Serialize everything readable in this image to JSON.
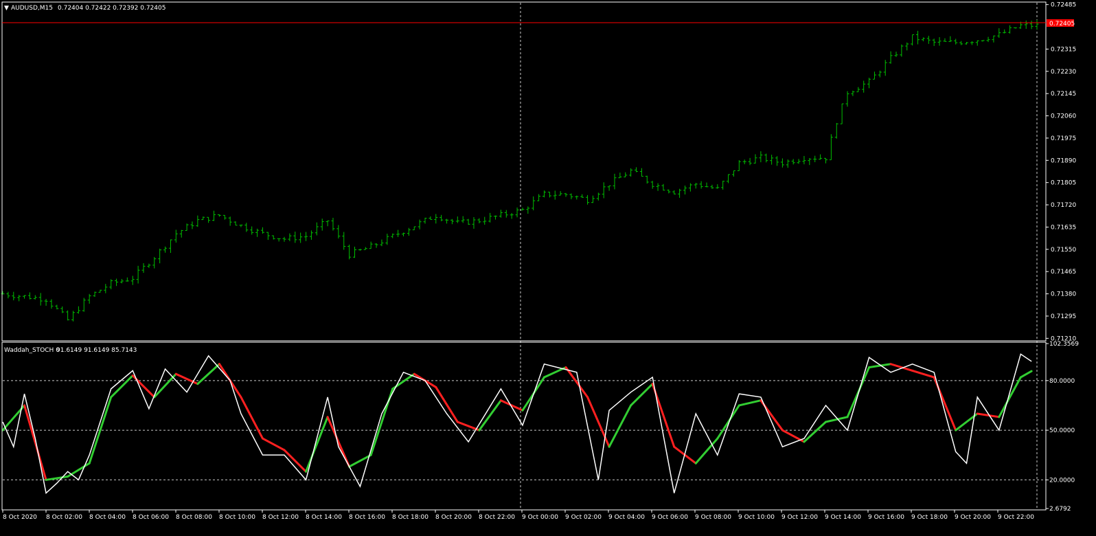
{
  "main_header": {
    "symbol": "AUDUSD,M15",
    "ohlc": "0.72404 0.72422 0.72392 0.72405"
  },
  "indicator_header": {
    "name": "Waddah_STOCH 0",
    "values": "91.6149 91.6149 85.7143"
  },
  "price_axis": {
    "ticks": [
      "0.72485",
      "0.72405",
      "0.72315",
      "0.72230",
      "0.72145",
      "0.72060",
      "0.71975",
      "0.71890",
      "0.71805",
      "0.71720",
      "0.71635",
      "0.71550",
      "0.71465",
      "0.71380",
      "0.71295",
      "0.71210"
    ],
    "current_price_label": "0.72405",
    "range": [
      0.71203,
      0.72492
    ]
  },
  "indicator_axis": {
    "ticks": [
      "102.3569",
      "80.0000",
      "50.0000",
      "20.0000",
      "2.6792"
    ],
    "levels": [
      80,
      50,
      20
    ],
    "range": [
      2.6792,
      102.3569
    ]
  },
  "time_axis": {
    "ticks": [
      "8 Oct 2020",
      "8 Oct 02:00",
      "8 Oct 04:00",
      "8 Oct 06:00",
      "8 Oct 08:00",
      "8 Oct 10:00",
      "8 Oct 12:00",
      "8 Oct 14:00",
      "8 Oct 16:00",
      "8 Oct 18:00",
      "8 Oct 20:00",
      "8 Oct 22:00",
      "9 Oct 00:00",
      "9 Oct 02:00",
      "9 Oct 04:00",
      "9 Oct 06:00",
      "9 Oct 08:00",
      "9 Oct 10:00",
      "9 Oct 12:00",
      "9 Oct 14:00",
      "9 Oct 16:00",
      "9 Oct 18:00",
      "9 Oct 20:00",
      "9 Oct 22:00"
    ]
  },
  "colors": {
    "background": "#000000",
    "candle": "#00c000",
    "current_price_line": "#ff0000",
    "axis_text": "#ffffff",
    "stoch_main": "#ffffff",
    "signal_up": "#32cd32",
    "signal_down": "#ff2020"
  },
  "chart_data": [
    {
      "type": "line",
      "chart": "price-bars",
      "title": "AUDUSD,M15",
      "timeframe_minutes": 15,
      "closing_price_path": [
        {
          "time": "8 Oct 2020 00:00",
          "close": 0.7138
        },
        {
          "time": "8 Oct 02:00",
          "close": 0.7136
        },
        {
          "time": "8 Oct 03:00",
          "close": 0.7128
        },
        {
          "time": "8 Oct 04:00",
          "close": 0.7137
        },
        {
          "time": "8 Oct 05:00",
          "close": 0.7142
        },
        {
          "time": "8 Oct 06:00",
          "close": 0.7144
        },
        {
          "time": "8 Oct 07:00",
          "close": 0.7152
        },
        {
          "time": "8 Oct 08:00",
          "close": 0.7161
        },
        {
          "time": "8 Oct 09:00",
          "close": 0.7166
        },
        {
          "time": "8 Oct 10:00",
          "close": 0.7168
        },
        {
          "time": "8 Oct 11:00",
          "close": 0.7164
        },
        {
          "time": "8 Oct 12:00",
          "close": 0.7161
        },
        {
          "time": "8 Oct 13:00",
          "close": 0.7159
        },
        {
          "time": "8 Oct 14:00",
          "close": 0.716
        },
        {
          "time": "8 Oct 15:00",
          "close": 0.7166
        },
        {
          "time": "8 Oct 16:00",
          "close": 0.7153
        },
        {
          "time": "8 Oct 17:00",
          "close": 0.7156
        },
        {
          "time": "8 Oct 18:00",
          "close": 0.716
        },
        {
          "time": "8 Oct 19:00",
          "close": 0.7164
        },
        {
          "time": "8 Oct 20:00",
          "close": 0.7168
        },
        {
          "time": "8 Oct 21:00",
          "close": 0.7165
        },
        {
          "time": "8 Oct 22:00",
          "close": 0.7166
        },
        {
          "time": "8 Oct 23:00",
          "close": 0.7168
        },
        {
          "time": "9 Oct 00:00",
          "close": 0.717
        },
        {
          "time": "9 Oct 01:00",
          "close": 0.7176
        },
        {
          "time": "9 Oct 02:00",
          "close": 0.7176
        },
        {
          "time": "9 Oct 03:00",
          "close": 0.7174
        },
        {
          "time": "9 Oct 04:00",
          "close": 0.718
        },
        {
          "time": "9 Oct 05:00",
          "close": 0.7185
        },
        {
          "time": "9 Oct 06:00",
          "close": 0.718
        },
        {
          "time": "9 Oct 07:00",
          "close": 0.7177
        },
        {
          "time": "9 Oct 08:00",
          "close": 0.718
        },
        {
          "time": "9 Oct 09:00",
          "close": 0.7178
        },
        {
          "time": "9 Oct 10:00",
          "close": 0.7188
        },
        {
          "time": "9 Oct 11:00",
          "close": 0.719
        },
        {
          "time": "9 Oct 12:00",
          "close": 0.7188
        },
        {
          "time": "9 Oct 13:00",
          "close": 0.719
        },
        {
          "time": "9 Oct 14:00",
          "close": 0.719
        },
        {
          "time": "9 Oct 14:30",
          "close": 0.7204
        },
        {
          "time": "9 Oct 15:00",
          "close": 0.7215
        },
        {
          "time": "9 Oct 16:00",
          "close": 0.7219
        },
        {
          "time": "9 Oct 17:00",
          "close": 0.7228
        },
        {
          "time": "9 Oct 18:00",
          "close": 0.7236
        },
        {
          "time": "9 Oct 19:00",
          "close": 0.7234
        },
        {
          "time": "9 Oct 20:00",
          "close": 0.7234
        },
        {
          "time": "9 Oct 21:00",
          "close": 0.7235
        },
        {
          "time": "9 Oct 22:00",
          "close": 0.7237
        },
        {
          "time": "9 Oct 23:00",
          "close": 0.72405
        }
      ],
      "current_price": 0.72405,
      "ylim": [
        0.71203,
        0.72492
      ]
    },
    {
      "type": "line",
      "chart": "stochastic",
      "title": "Waddah_STOCH 0",
      "ylim": [
        2.6792,
        102.3569
      ],
      "levels": [
        80,
        50,
        20
      ],
      "main_line": [
        {
          "time": "8 Oct 2020 00:00",
          "value": 55
        },
        {
          "time": "8 Oct 00:30",
          "value": 40
        },
        {
          "time": "8 Oct 01:00",
          "value": 72
        },
        {
          "time": "8 Oct 01:30",
          "value": 45
        },
        {
          "time": "8 Oct 02:00",
          "value": 12
        },
        {
          "time": "8 Oct 02:30",
          "value": 18
        },
        {
          "time": "8 Oct 03:00",
          "value": 25
        },
        {
          "time": "8 Oct 03:30",
          "value": 20
        },
        {
          "time": "8 Oct 04:00",
          "value": 35
        },
        {
          "time": "8 Oct 05:00",
          "value": 75
        },
        {
          "time": "8 Oct 06:00",
          "value": 86
        },
        {
          "time": "8 Oct 06:45",
          "value": 63
        },
        {
          "time": "8 Oct 07:30",
          "value": 87
        },
        {
          "time": "8 Oct 08:30",
          "value": 73
        },
        {
          "time": "8 Oct 09:30",
          "value": 95
        },
        {
          "time": "8 Oct 10:30",
          "value": 80
        },
        {
          "time": "8 Oct 11:00",
          "value": 60
        },
        {
          "time": "8 Oct 12:00",
          "value": 35
        },
        {
          "time": "8 Oct 13:00",
          "value": 35
        },
        {
          "time": "8 Oct 14:00",
          "value": 20
        },
        {
          "time": "8 Oct 15:00",
          "value": 70
        },
        {
          "time": "8 Oct 15:30",
          "value": 40
        },
        {
          "time": "8 Oct 16:30",
          "value": 16
        },
        {
          "time": "8 Oct 17:30",
          "value": 60
        },
        {
          "time": "8 Oct 18:30",
          "value": 85
        },
        {
          "time": "8 Oct 19:30",
          "value": 80
        },
        {
          "time": "8 Oct 20:30",
          "value": 60
        },
        {
          "time": "8 Oct 21:30",
          "value": 43
        },
        {
          "time": "8 Oct 23:00",
          "value": 75
        },
        {
          "time": "9 Oct 00:00",
          "value": 53
        },
        {
          "time": "9 Oct 01:00",
          "value": 90
        },
        {
          "time": "9 Oct 02:30",
          "value": 85
        },
        {
          "time": "9 Oct 03:30",
          "value": 20
        },
        {
          "time": "9 Oct 04:00",
          "value": 62
        },
        {
          "time": "9 Oct 05:00",
          "value": 73
        },
        {
          "time": "9 Oct 06:00",
          "value": 82
        },
        {
          "time": "9 Oct 07:00",
          "value": 12
        },
        {
          "time": "9 Oct 08:00",
          "value": 60
        },
        {
          "time": "9 Oct 09:00",
          "value": 35
        },
        {
          "time": "9 Oct 10:00",
          "value": 72
        },
        {
          "time": "9 Oct 11:00",
          "value": 70
        },
        {
          "time": "9 Oct 12:00",
          "value": 40
        },
        {
          "time": "9 Oct 13:00",
          "value": 45
        },
        {
          "time": "9 Oct 14:00",
          "value": 65
        },
        {
          "time": "9 Oct 15:00",
          "value": 50
        },
        {
          "time": "9 Oct 16:00",
          "value": 94
        },
        {
          "time": "9 Oct 17:00",
          "value": 85
        },
        {
          "time": "9 Oct 18:00",
          "value": 90
        },
        {
          "time": "9 Oct 19:00",
          "value": 85
        },
        {
          "time": "9 Oct 20:00",
          "value": 37
        },
        {
          "time": "9 Oct 20:30",
          "value": 30
        },
        {
          "time": "9 Oct 21:00",
          "value": 70
        },
        {
          "time": "9 Oct 22:00",
          "value": 50
        },
        {
          "time": "9 Oct 23:00",
          "value": 96
        },
        {
          "time": "9 Oct 23:30",
          "value": 91.6149
        }
      ],
      "signal_line": [
        {
          "time": "8 Oct 2020 00:00",
          "value": 50
        },
        {
          "time": "8 Oct 01:00",
          "value": 65
        },
        {
          "time": "8 Oct 02:00",
          "value": 20
        },
        {
          "time": "8 Oct 03:00",
          "value": 22
        },
        {
          "time": "8 Oct 04:00",
          "value": 30
        },
        {
          "time": "8 Oct 05:00",
          "value": 70
        },
        {
          "time": "8 Oct 06:00",
          "value": 83
        },
        {
          "time": "8 Oct 07:00",
          "value": 70
        },
        {
          "time": "8 Oct 08:00",
          "value": 84
        },
        {
          "time": "8 Oct 09:00",
          "value": 78
        },
        {
          "time": "8 Oct 10:00",
          "value": 90
        },
        {
          "time": "8 Oct 11:00",
          "value": 70
        },
        {
          "time": "8 Oct 12:00",
          "value": 45
        },
        {
          "time": "8 Oct 13:00",
          "value": 38
        },
        {
          "time": "8 Oct 14:00",
          "value": 25
        },
        {
          "time": "8 Oct 15:00",
          "value": 58
        },
        {
          "time": "8 Oct 16:00",
          "value": 28
        },
        {
          "time": "8 Oct 17:00",
          "value": 35
        },
        {
          "time": "8 Oct 18:00",
          "value": 75
        },
        {
          "time": "8 Oct 19:00",
          "value": 84
        },
        {
          "time": "8 Oct 20:00",
          "value": 76
        },
        {
          "time": "8 Oct 21:00",
          "value": 55
        },
        {
          "time": "8 Oct 22:00",
          "value": 50
        },
        {
          "time": "8 Oct 23:00",
          "value": 68
        },
        {
          "time": "9 Oct 00:00",
          "value": 62
        },
        {
          "time": "9 Oct 01:00",
          "value": 82
        },
        {
          "time": "9 Oct 02:00",
          "value": 88
        },
        {
          "time": "9 Oct 03:00",
          "value": 70
        },
        {
          "time": "9 Oct 04:00",
          "value": 40
        },
        {
          "time": "9 Oct 05:00",
          "value": 65
        },
        {
          "time": "9 Oct 06:00",
          "value": 78
        },
        {
          "time": "9 Oct 07:00",
          "value": 40
        },
        {
          "time": "9 Oct 08:00",
          "value": 30
        },
        {
          "time": "9 Oct 09:00",
          "value": 45
        },
        {
          "time": "9 Oct 10:00",
          "value": 65
        },
        {
          "time": "9 Oct 11:00",
          "value": 68
        },
        {
          "time": "9 Oct 12:00",
          "value": 50
        },
        {
          "time": "9 Oct 13:00",
          "value": 43
        },
        {
          "time": "9 Oct 14:00",
          "value": 55
        },
        {
          "time": "9 Oct 15:00",
          "value": 58
        },
        {
          "time": "9 Oct 16:00",
          "value": 88
        },
        {
          "time": "9 Oct 17:00",
          "value": 90
        },
        {
          "time": "9 Oct 18:00",
          "value": 86
        },
        {
          "time": "9 Oct 19:00",
          "value": 82
        },
        {
          "time": "9 Oct 20:00",
          "value": 50
        },
        {
          "time": "9 Oct 21:00",
          "value": 60
        },
        {
          "time": "9 Oct 22:00",
          "value": 58
        },
        {
          "time": "9 Oct 23:00",
          "value": 82
        },
        {
          "time": "9 Oct 23:30",
          "value": 85.7143
        }
      ]
    }
  ]
}
